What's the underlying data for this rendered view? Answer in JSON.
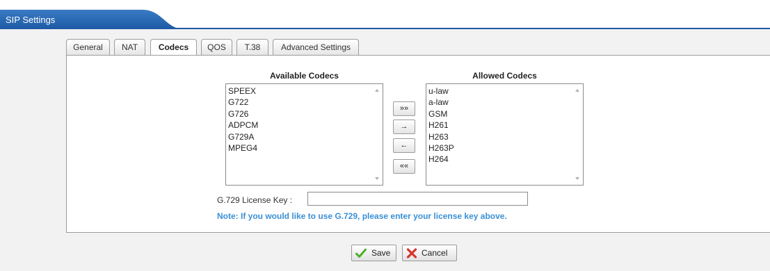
{
  "header": {
    "title": "SIP Settings"
  },
  "tabs": [
    {
      "label": "General"
    },
    {
      "label": "NAT"
    },
    {
      "label": "Codecs"
    },
    {
      "label": "QOS"
    },
    {
      "label": "T.38"
    },
    {
      "label": "Advanced Settings"
    }
  ],
  "active_tab": "Codecs",
  "codecs": {
    "available_title": "Available Codecs",
    "available": [
      "SPEEX",
      "G722",
      "G726",
      "ADPCM",
      "G729A",
      "MPEG4"
    ],
    "allowed_title": "Allowed Codecs",
    "allowed": [
      "u-law",
      "a-law",
      "GSM",
      "H261",
      "H263",
      "H263P",
      "H264"
    ],
    "buttons": {
      "add_all": "»»",
      "add": "→",
      "remove": "←",
      "remove_all": "««"
    }
  },
  "license": {
    "label": "G.729 License Key :",
    "value": "",
    "note": "Note: If you would like to use G.729, please enter your license key above."
  },
  "actions": {
    "save": "Save",
    "cancel": "Cancel"
  },
  "colors": {
    "brand_blue": "#1e5aa5",
    "note_blue": "#3a8fd6",
    "save_icon": "#4caf2a",
    "cancel_icon": "#d9342b"
  }
}
